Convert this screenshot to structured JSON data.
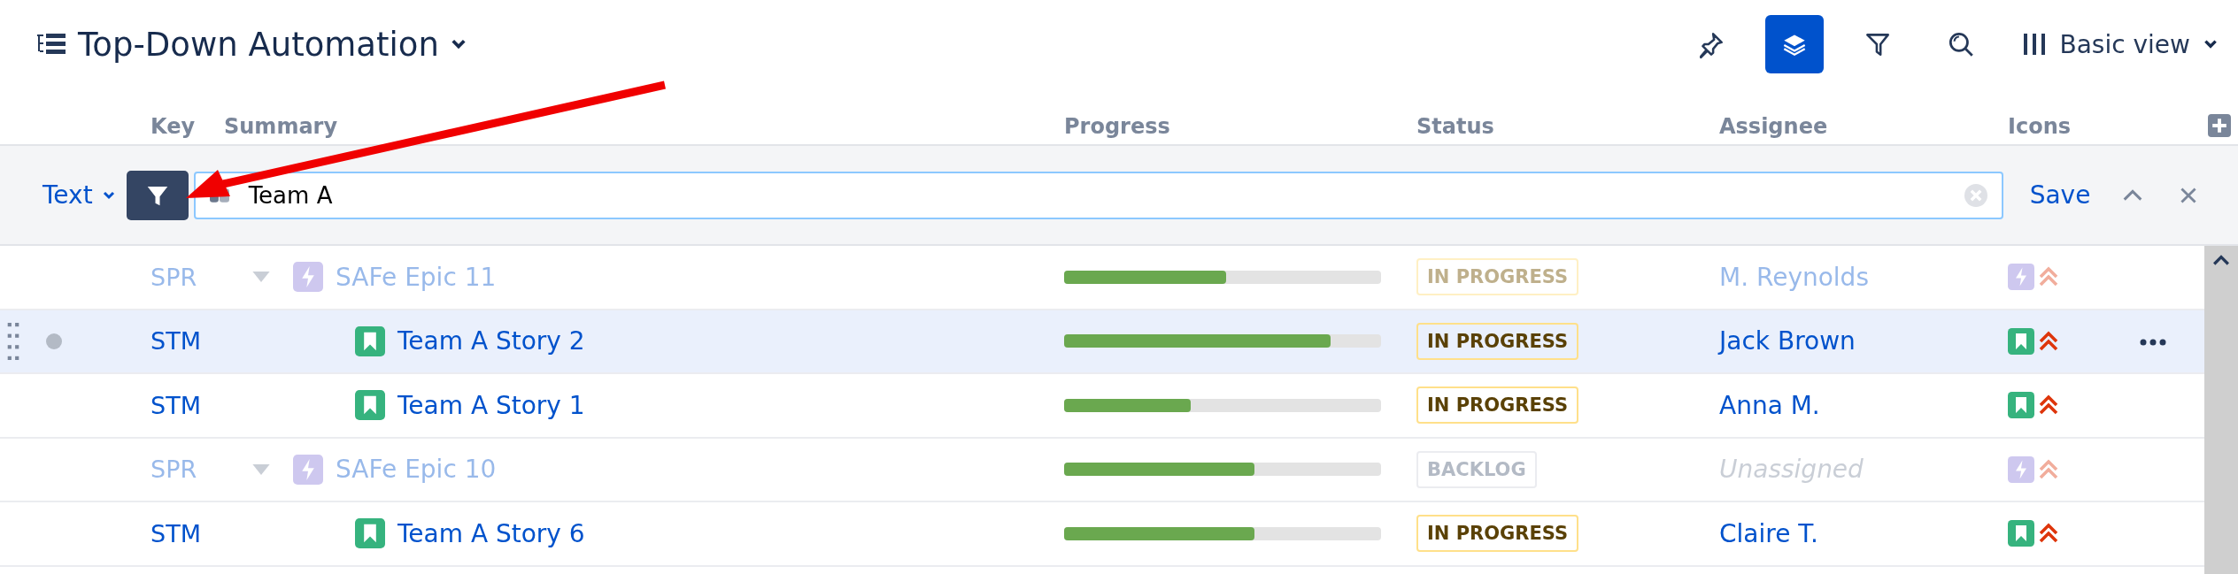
{
  "title": "Top-Down Automation",
  "toolbar": [
    {
      "kind": "pin",
      "selected": false
    },
    {
      "kind": "layers",
      "selected": true
    },
    {
      "kind": "filter",
      "selected": false
    },
    {
      "kind": "search",
      "selected": false
    }
  ],
  "view": "Basic view",
  "columns": [
    "Key",
    "Summary",
    "Progress",
    "Status",
    "Assignee",
    "Icons"
  ],
  "filter": {
    "mode": "Text",
    "value": "Team A",
    "save": "Save"
  },
  "rows": [
    {
      "kind": "epic",
      "key": "SPR",
      "summary": "SAFe Epic 11",
      "level": 0.51,
      "status": "IN PROGRESS",
      "color": "#bfb08c",
      "assignee": "M. Reynolds",
      "assigned": true,
      "selected": false
    },
    {
      "kind": "story",
      "key": "STM",
      "summary": "Team A Story 2",
      "level": 0.84,
      "status": "IN PROGRESS",
      "color": "#5a4106",
      "assignee": "Jack Brown",
      "assigned": true,
      "selected": true
    },
    {
      "kind": "story",
      "key": "STM",
      "summary": "Team A Story 1",
      "level": 0.4,
      "status": "IN PROGRESS",
      "color": "#5a4106",
      "assignee": "Anna M.",
      "assigned": true,
      "selected": false
    },
    {
      "kind": "epic",
      "key": "SPR",
      "summary": "SAFe Epic 10",
      "level": 0.6,
      "status": "BACKLOG",
      "color": "#b3bac5",
      "assignee": "Unassigned",
      "assigned": false,
      "selected": false
    },
    {
      "kind": "story",
      "key": "STM",
      "summary": "Team A Story 6",
      "level": 0.6,
      "status": "IN PROGRESS",
      "color": "#5a4106",
      "assignee": "Claire T.",
      "assigned": true,
      "selected": false
    }
  ]
}
